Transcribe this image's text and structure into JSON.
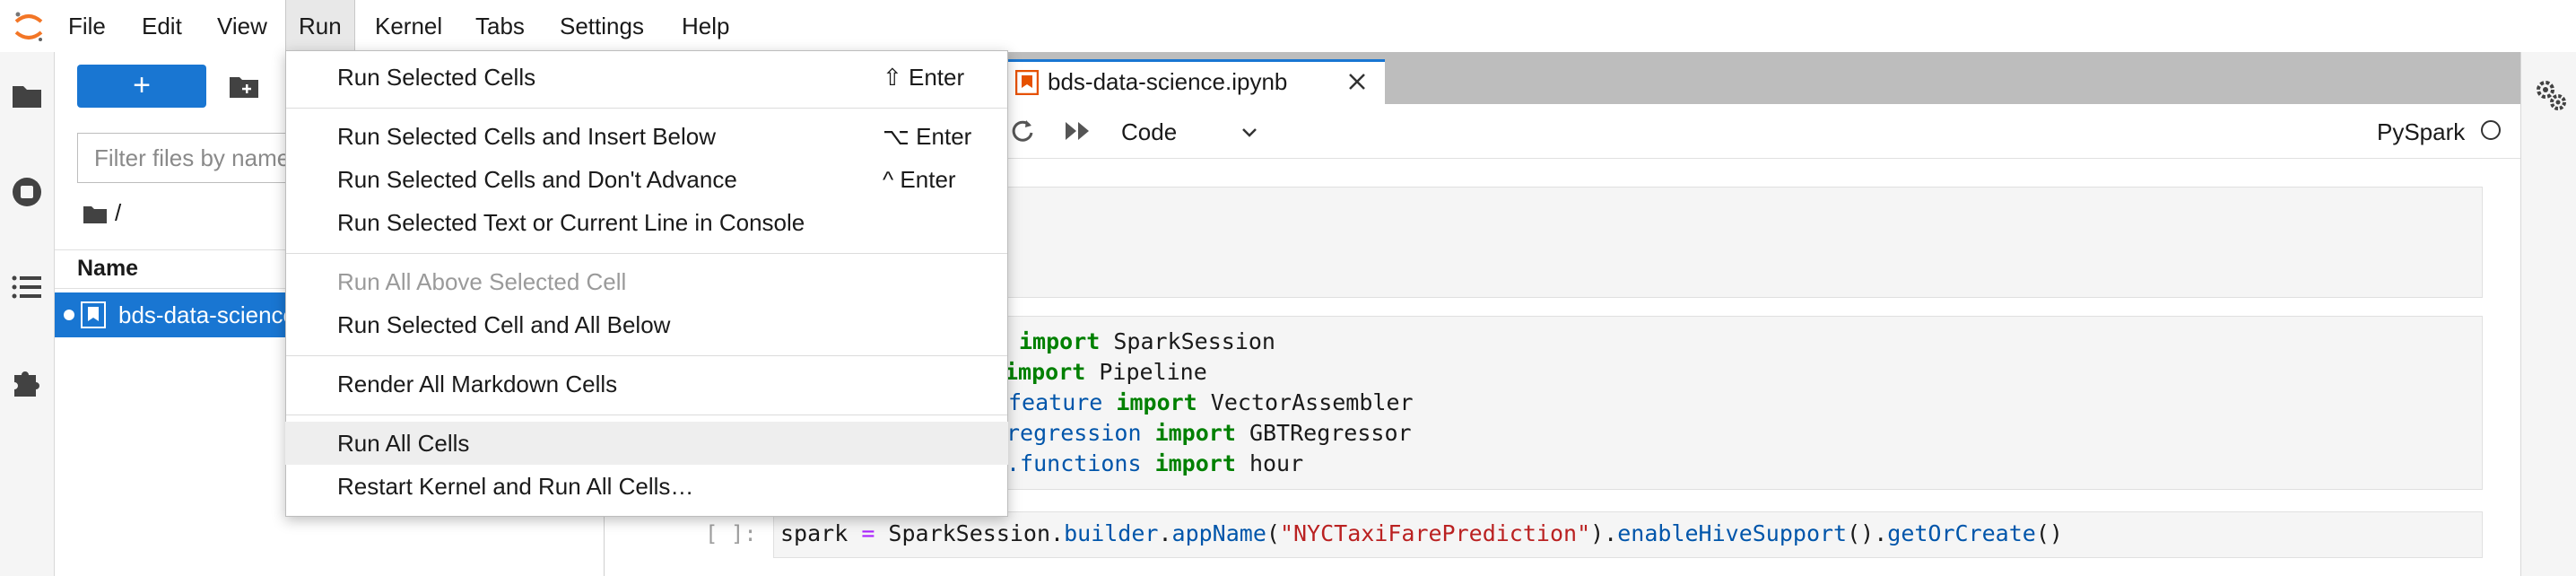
{
  "menubar": {
    "items": [
      "File",
      "Edit",
      "View",
      "Run",
      "Kernel",
      "Tabs",
      "Settings",
      "Help"
    ],
    "active": "Run"
  },
  "filebrowser": {
    "new_label": "+",
    "filter_placeholder": "Filter files by name",
    "breadcrumb": "/",
    "column_name": "Name",
    "files": [
      {
        "name": "bds-data-science.ipynb",
        "running": true,
        "selected": true
      }
    ]
  },
  "notebook": {
    "tab_label": "bds-data-science.ipynb",
    "cell_type": "Code",
    "kernel": "PySpark",
    "cells": [
      {
        "prompt": "",
        "lines": []
      },
      {
        "prompt": "",
        "lines": [
          {
            "pre": "",
            "kw": "import",
            "post": " SparkSession"
          },
          {
            "pre": "",
            "kw": "import",
            "post": " Pipeline"
          },
          {
            "pre": "feature ",
            "kw": "import",
            "post": " VectorAssembler"
          },
          {
            "pre": "regression ",
            "kw": "import",
            "post": " GBTRegressor"
          },
          {
            "pre": ".functions ",
            "kw": "import",
            "post": " hour"
          }
        ]
      },
      {
        "prompt": "[ ]:",
        "code": {
          "var": "spark",
          "eq": " = ",
          "obj": "SparkSession.",
          "m1": "builder",
          "d1": ".",
          "m2": "appName",
          "p1": "(",
          "s1": "\"NYCTaxiFarePrediction\"",
          "p2": ").",
          "m3": "enableHiveSupport",
          "p3": "().",
          "m4": "getOrCreate",
          "p4": "()"
        }
      }
    ]
  },
  "run_menu": {
    "items": [
      {
        "label": "Run Selected Cells",
        "shortcut": "⇧ Enter",
        "disabled": false
      },
      {
        "label": "Run Selected Cells and Insert Below",
        "shortcut": "⌥ Enter",
        "disabled": false
      },
      {
        "label": "Run Selected Cells and Don't Advance",
        "shortcut": "^ Enter",
        "disabled": false
      },
      {
        "label": "Run Selected Text or Current Line in Console",
        "shortcut": "",
        "disabled": false
      },
      {
        "label": "Run All Above Selected Cell",
        "shortcut": "",
        "disabled": true
      },
      {
        "label": "Run Selected Cell and All Below",
        "shortcut": "",
        "disabled": false
      },
      {
        "label": "Render All Markdown Cells",
        "shortcut": "",
        "disabled": false
      },
      {
        "label": "Run All Cells",
        "shortcut": "",
        "disabled": false,
        "hovered": true
      },
      {
        "label": "Restart Kernel and Run All Cells…",
        "shortcut": "",
        "disabled": false
      }
    ]
  },
  "colors": {
    "accent": "#1976d2",
    "keyword": "#008000",
    "string": "#ba2121",
    "attribute": "#0055aa",
    "operator": "#aa22ff",
    "notebook_icon": "#e65100"
  }
}
